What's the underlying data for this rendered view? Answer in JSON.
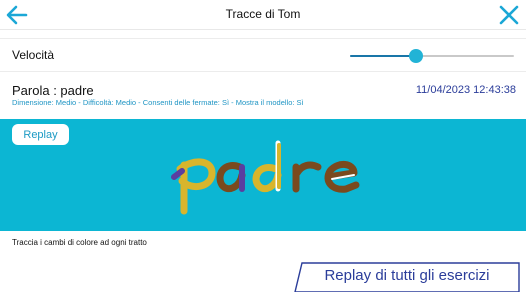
{
  "header": {
    "title": "Tracce di Tom",
    "back_icon": "arrow-left-icon",
    "close_icon": "close-icon",
    "accent_color": "#1ba7d6"
  },
  "speed": {
    "label": "Velocità",
    "value_fraction": 0.4
  },
  "exercise": {
    "word_line": "Parola : padre",
    "datetime": "11/04/2023 12:43:38",
    "details": "Dimensione: Medio - Difficoltà: Medio - Consenti delle fermate: Sì - Mostra il modello: Sì"
  },
  "canvas": {
    "background": "#0cb6d3",
    "replay_label": "Replay",
    "stroke_colors": [
      "#d8b52c",
      "#5a3ea0",
      "#7a4a1e",
      "#ffffff"
    ]
  },
  "hint": "Traccia i cambi di colore ad ogni tratto",
  "footer": {
    "replay_all_label": "Replay di tutti gli esercizi"
  }
}
